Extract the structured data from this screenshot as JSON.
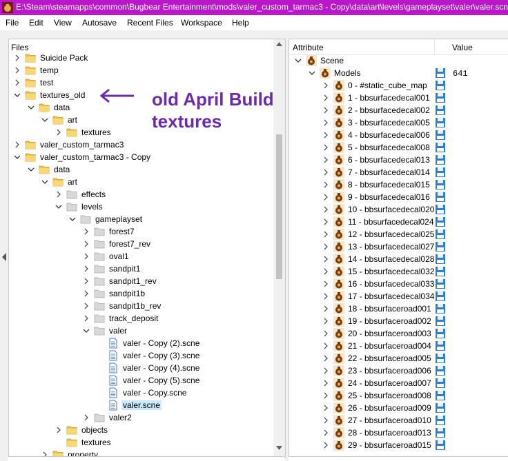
{
  "window": {
    "title": "E:\\Steam\\steamapps\\common\\Bugbear Entertainment\\mods\\valer_custom_tarmac3 - Copy\\data\\art\\levels\\gameplayset\\valer\\valer.scne"
  },
  "menu": [
    "File",
    "Edit",
    "View",
    "Autosave",
    "Recent Files",
    "Workspace",
    "Help"
  ],
  "files_panel": {
    "label": "Files"
  },
  "tree": [
    {
      "label": "Suicide Pack",
      "depth": 1,
      "type": "folder",
      "state": "collapsed"
    },
    {
      "label": "temp",
      "depth": 1,
      "type": "folder",
      "state": "collapsed"
    },
    {
      "label": "test",
      "depth": 1,
      "type": "folder",
      "state": "collapsed"
    },
    {
      "label": "textures_old",
      "depth": 1,
      "type": "folder",
      "state": "expanded"
    },
    {
      "label": "data",
      "depth": 2,
      "type": "folder",
      "state": "expanded"
    },
    {
      "label": "art",
      "depth": 3,
      "type": "folder",
      "state": "expanded"
    },
    {
      "label": "textures",
      "depth": 4,
      "type": "folder",
      "state": "collapsed"
    },
    {
      "label": "valer_custom_tarmac3",
      "depth": 1,
      "type": "folder",
      "state": "collapsed"
    },
    {
      "label": "valer_custom_tarmac3 - Copy",
      "depth": 1,
      "type": "folder",
      "state": "expanded"
    },
    {
      "label": "data",
      "depth": 2,
      "type": "folder",
      "state": "expanded"
    },
    {
      "label": "art",
      "depth": 3,
      "type": "folder",
      "state": "expanded"
    },
    {
      "label": "effects",
      "depth": 4,
      "type": "folder",
      "state": "collapsed"
    },
    {
      "label": "levels",
      "depth": 4,
      "type": "folder",
      "state": "expanded"
    },
    {
      "label": "gameplayset",
      "depth": 5,
      "type": "folder",
      "state": "expanded"
    },
    {
      "label": "forest7",
      "depth": 6,
      "type": "folder",
      "state": "collapsed"
    },
    {
      "label": "forest7_rev",
      "depth": 6,
      "type": "folder",
      "state": "collapsed"
    },
    {
      "label": "oval1",
      "depth": 6,
      "type": "folder",
      "state": "collapsed"
    },
    {
      "label": "sandpit1",
      "depth": 6,
      "type": "folder",
      "state": "collapsed"
    },
    {
      "label": "sandpit1_rev",
      "depth": 6,
      "type": "folder",
      "state": "collapsed"
    },
    {
      "label": "sandpit1b",
      "depth": 6,
      "type": "folder",
      "state": "collapsed"
    },
    {
      "label": "sandpit1b_rev",
      "depth": 6,
      "type": "folder",
      "state": "collapsed"
    },
    {
      "label": "track_deposit",
      "depth": 6,
      "type": "folder",
      "state": "collapsed"
    },
    {
      "label": "valer",
      "depth": 6,
      "type": "folder",
      "state": "expanded"
    },
    {
      "label": "valer - Copy (2).scne",
      "depth": 7,
      "type": "file",
      "state": "none"
    },
    {
      "label": "valer - Copy (3).scne",
      "depth": 7,
      "type": "file",
      "state": "none"
    },
    {
      "label": "valer - Copy (4).scne",
      "depth": 7,
      "type": "file",
      "state": "none"
    },
    {
      "label": "valer - Copy (5).scne",
      "depth": 7,
      "type": "file",
      "state": "none"
    },
    {
      "label": "valer - Copy.scne",
      "depth": 7,
      "type": "file",
      "state": "none"
    },
    {
      "label": "valer.scne",
      "depth": 7,
      "type": "file",
      "state": "selected"
    },
    {
      "label": "valer2",
      "depth": 6,
      "type": "folder",
      "state": "collapsed"
    },
    {
      "label": "objects",
      "depth": 4,
      "type": "folder",
      "state": "collapsed"
    },
    {
      "label": "textures",
      "depth": 4,
      "type": "folder",
      "state": "none"
    },
    {
      "label": "property",
      "depth": 3,
      "type": "folder",
      "state": "collapsed"
    }
  ],
  "annotation": {
    "line1": "old April Build",
    "line2": "textures",
    "color": "#6a2caa"
  },
  "attributes_panel": {
    "header_attribute": "Attribute",
    "header_value": "Value",
    "scene_label": "Scene",
    "models_label": "Models",
    "models_value": "641",
    "models": [
      "0 - #static_cube_map",
      "1 - bbsurfacedecal001",
      "2 - bbsurfacedecal002",
      "3 - bbsurfacedecal005",
      "4 - bbsurfacedecal006",
      "5 - bbsurfacedecal008",
      "6 - bbsurfacedecal013",
      "7 - bbsurfacedecal014",
      "8 - bbsurfacedecal015",
      "9 - bbsurfacedecal016",
      "10 - bbsurfacedecal020",
      "11 - bbsurfacedecal024",
      "12 - bbsurfacedecal025",
      "13 - bbsurfacedecal027",
      "14 - bbsurfacedecal028",
      "15 - bbsurfacedecal032",
      "16 - bbsurfacedecal033",
      "17 - bbsurfacedecal034",
      "18 - bbsurfaceroad001",
      "19 - bbsurfaceroad002",
      "20 - bbsurfaceroad003",
      "21 - bbsurfaceroad004",
      "22 - bbsurfaceroad005",
      "23 - bbsurfaceroad006",
      "24 - bbsurfaceroad007",
      "25 - bbsurfaceroad008",
      "26 - bbsurfaceroad009",
      "27 - bbsurfaceroad010",
      "28 - bbsurfaceroad013",
      "29 - bbsurfaceroad015"
    ]
  },
  "colors": {
    "titlebar": "#b818c8",
    "folder": "#f2c14e",
    "selection": "#cce8ff"
  },
  "icons": {
    "folder": "folder-icon",
    "file": "document-icon",
    "model": "model-icon",
    "save": "save-icon",
    "app": "bugbear-app-icon"
  }
}
